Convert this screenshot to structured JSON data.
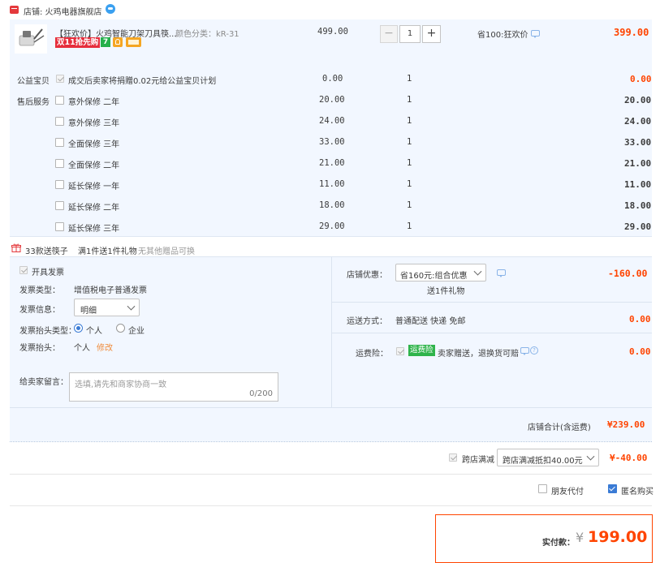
{
  "shop": {
    "label": "店铺: 火鸡电器旗舰店"
  },
  "product": {
    "title": "【狂欢价】火鸡智能刀架刀具筷...",
    "spec_label": "颜色分类：kR-31",
    "badge_text": "双11抢先购",
    "unit_price": "499.00",
    "quantity": "1",
    "discount": "省100:狂欢价",
    "subtotal": "399.00"
  },
  "charity": {
    "label": "公益宝贝",
    "text": "成交后卖家将捐赠0.02元给公益宝贝计划",
    "price": "0.00",
    "qty": "1",
    "subtotal": "0.00"
  },
  "services": {
    "label": "售后服务",
    "items": [
      {
        "name": "意外保修 二年",
        "price": "20.00",
        "qty": "1",
        "subtotal": "20.00"
      },
      {
        "name": "意外保修 三年",
        "price": "24.00",
        "qty": "1",
        "subtotal": "24.00"
      },
      {
        "name": "全面保修 三年",
        "price": "33.00",
        "qty": "1",
        "subtotal": "33.00"
      },
      {
        "name": "全面保修 二年",
        "price": "21.00",
        "qty": "1",
        "subtotal": "21.00"
      },
      {
        "name": "延长保修 一年",
        "price": "11.00",
        "qty": "1",
        "subtotal": "11.00"
      },
      {
        "name": "延长保修 二年",
        "price": "18.00",
        "qty": "1",
        "subtotal": "18.00"
      },
      {
        "name": "延长保修 三年",
        "price": "29.00",
        "qty": "1",
        "subtotal": "29.00"
      }
    ]
  },
  "gift": {
    "name": "33款送筷子",
    "rule": "满1件送1件礼物",
    "note": "无其他赠品可换"
  },
  "invoice": {
    "toggle_label": "开具发票",
    "type_label": "发票类型：",
    "type_value": "增值税电子普通发票",
    "info_label": "发票信息：",
    "info_value": "明细",
    "header_type_label": "发票抬头类型：",
    "option_personal": "个人",
    "option_company": "企业",
    "header_label": "发票抬头：",
    "header_value": "个人",
    "edit_link": "修改"
  },
  "message": {
    "label": "给卖家留言：",
    "placeholder": "选填,请先和商家协商一致",
    "counter": "0/200"
  },
  "shop_discount": {
    "label": "店铺优惠：",
    "selected": "省160元:组合优惠",
    "gift_note": "送1件礼物",
    "amount": "-160.00"
  },
  "shipping": {
    "label": "运送方式：",
    "value": "普通配送 快递 免邮",
    "amount": "0.00"
  },
  "insurance": {
    "label": "运费险：",
    "tag": "运费险",
    "text": "卖家赠送，退换货可赔",
    "amount": "0.00"
  },
  "shop_total": {
    "label": "店铺合计(含运费)",
    "amount": "¥239.00"
  },
  "cross_store": {
    "label": "跨店满减",
    "selected": "跨店满减抵扣40.00元",
    "amount": "¥-40.00"
  },
  "options": {
    "friend_pay": "朋友代付",
    "anonymous": "匿名购买"
  },
  "payment": {
    "label": "实付款：",
    "currency": "¥",
    "amount": "199.00"
  },
  "colors": {
    "accent": "#ff4400",
    "panel_bg": "#f2f7ff",
    "checkbox_blue": "#3a7bd5",
    "tag_green": "#2fb44b"
  }
}
